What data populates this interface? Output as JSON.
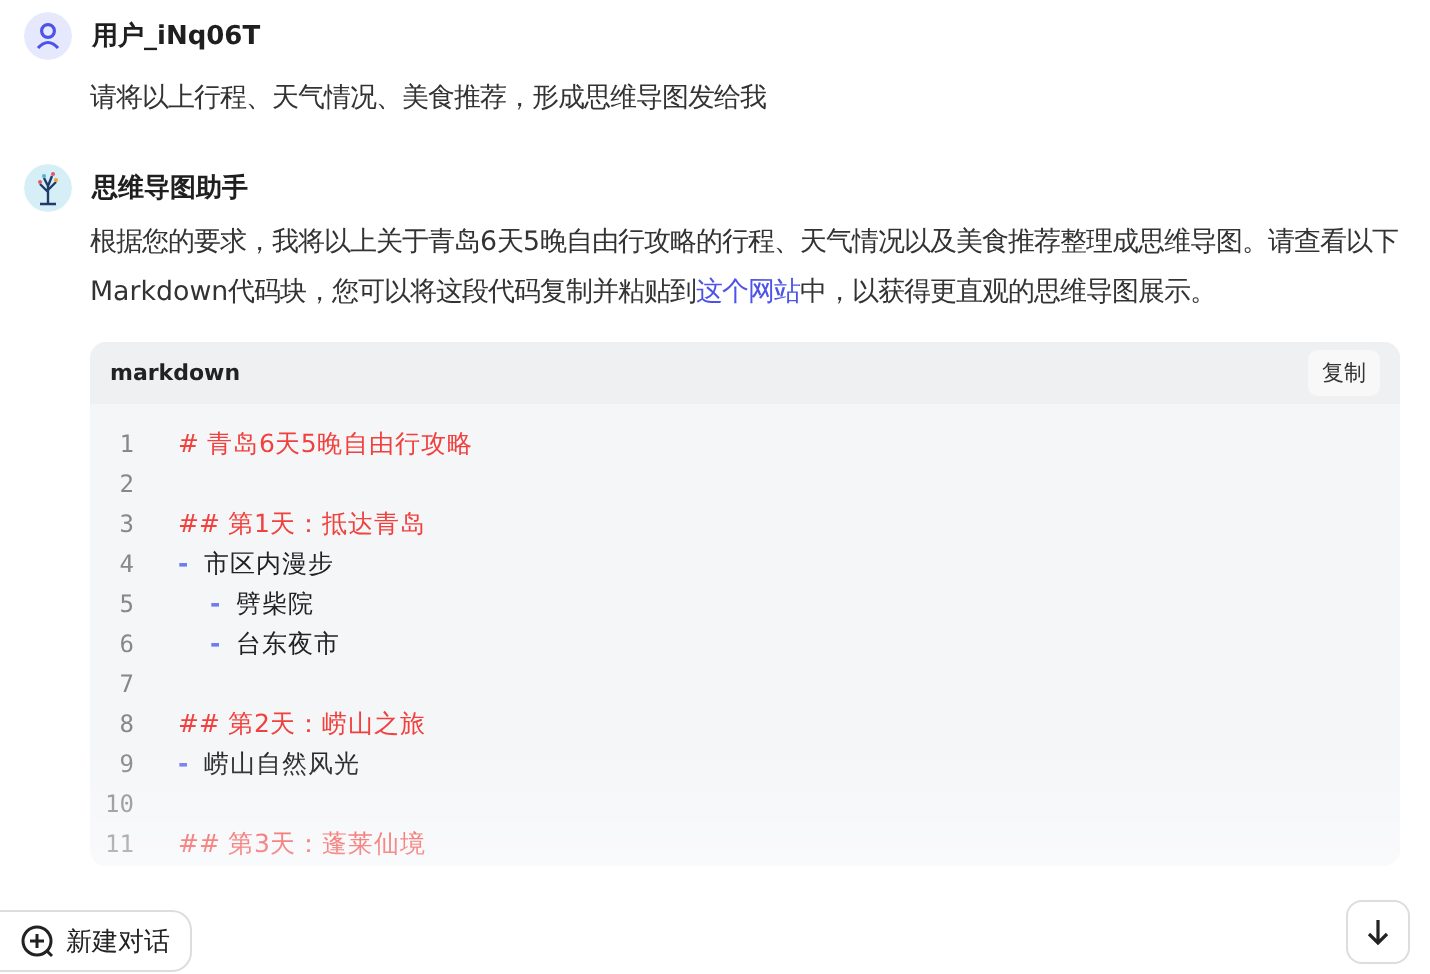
{
  "messages": [
    {
      "kind": "user",
      "author": "用户_iNq06T",
      "text": "请将以上行程、天气情况、美食推荐，形成思维导图发给我"
    },
    {
      "kind": "assistant",
      "author": "思维导图助手",
      "text_before": "根据您的要求，我将以上关于青岛6天5晚自由行攻略的行程、天气情况以及美食推荐整理成思维导图。请查看以下Markdown代码块，您可以将这段代码复制并粘贴到",
      "link": "这个网站",
      "text_after": "中，以获得更直观的思维导图展示。",
      "code_block": {
        "language": "markdown",
        "copy_label": "复制",
        "lines": [
          {
            "number": "1",
            "kind": "heading",
            "marker": "#",
            "text": "青岛6天5晚自由行攻略"
          },
          {
            "number": "2",
            "kind": "blank"
          },
          {
            "number": "3",
            "kind": "heading",
            "marker": "##",
            "text": "第1天：抵达青岛"
          },
          {
            "number": "4",
            "kind": "bullet",
            "marker": "-",
            "text": "市区内漫步"
          },
          {
            "number": "5",
            "kind": "sub_bullet",
            "marker": "-",
            "text": "劈柴院"
          },
          {
            "number": "6",
            "kind": "sub_bullet",
            "marker": "-",
            "text": "台东夜市"
          },
          {
            "number": "7",
            "kind": "blank"
          },
          {
            "number": "8",
            "kind": "heading",
            "marker": "##",
            "text": "第2天：崂山之旅"
          },
          {
            "number": "9",
            "kind": "bullet",
            "marker": "-",
            "text": "崂山自然风光"
          },
          {
            "number": "10",
            "kind": "blank"
          },
          {
            "number": "11",
            "kind": "heading",
            "marker": "##",
            "text": "第3天：蓬莱仙境"
          }
        ]
      }
    }
  ],
  "new_chat_label": "新建对话"
}
